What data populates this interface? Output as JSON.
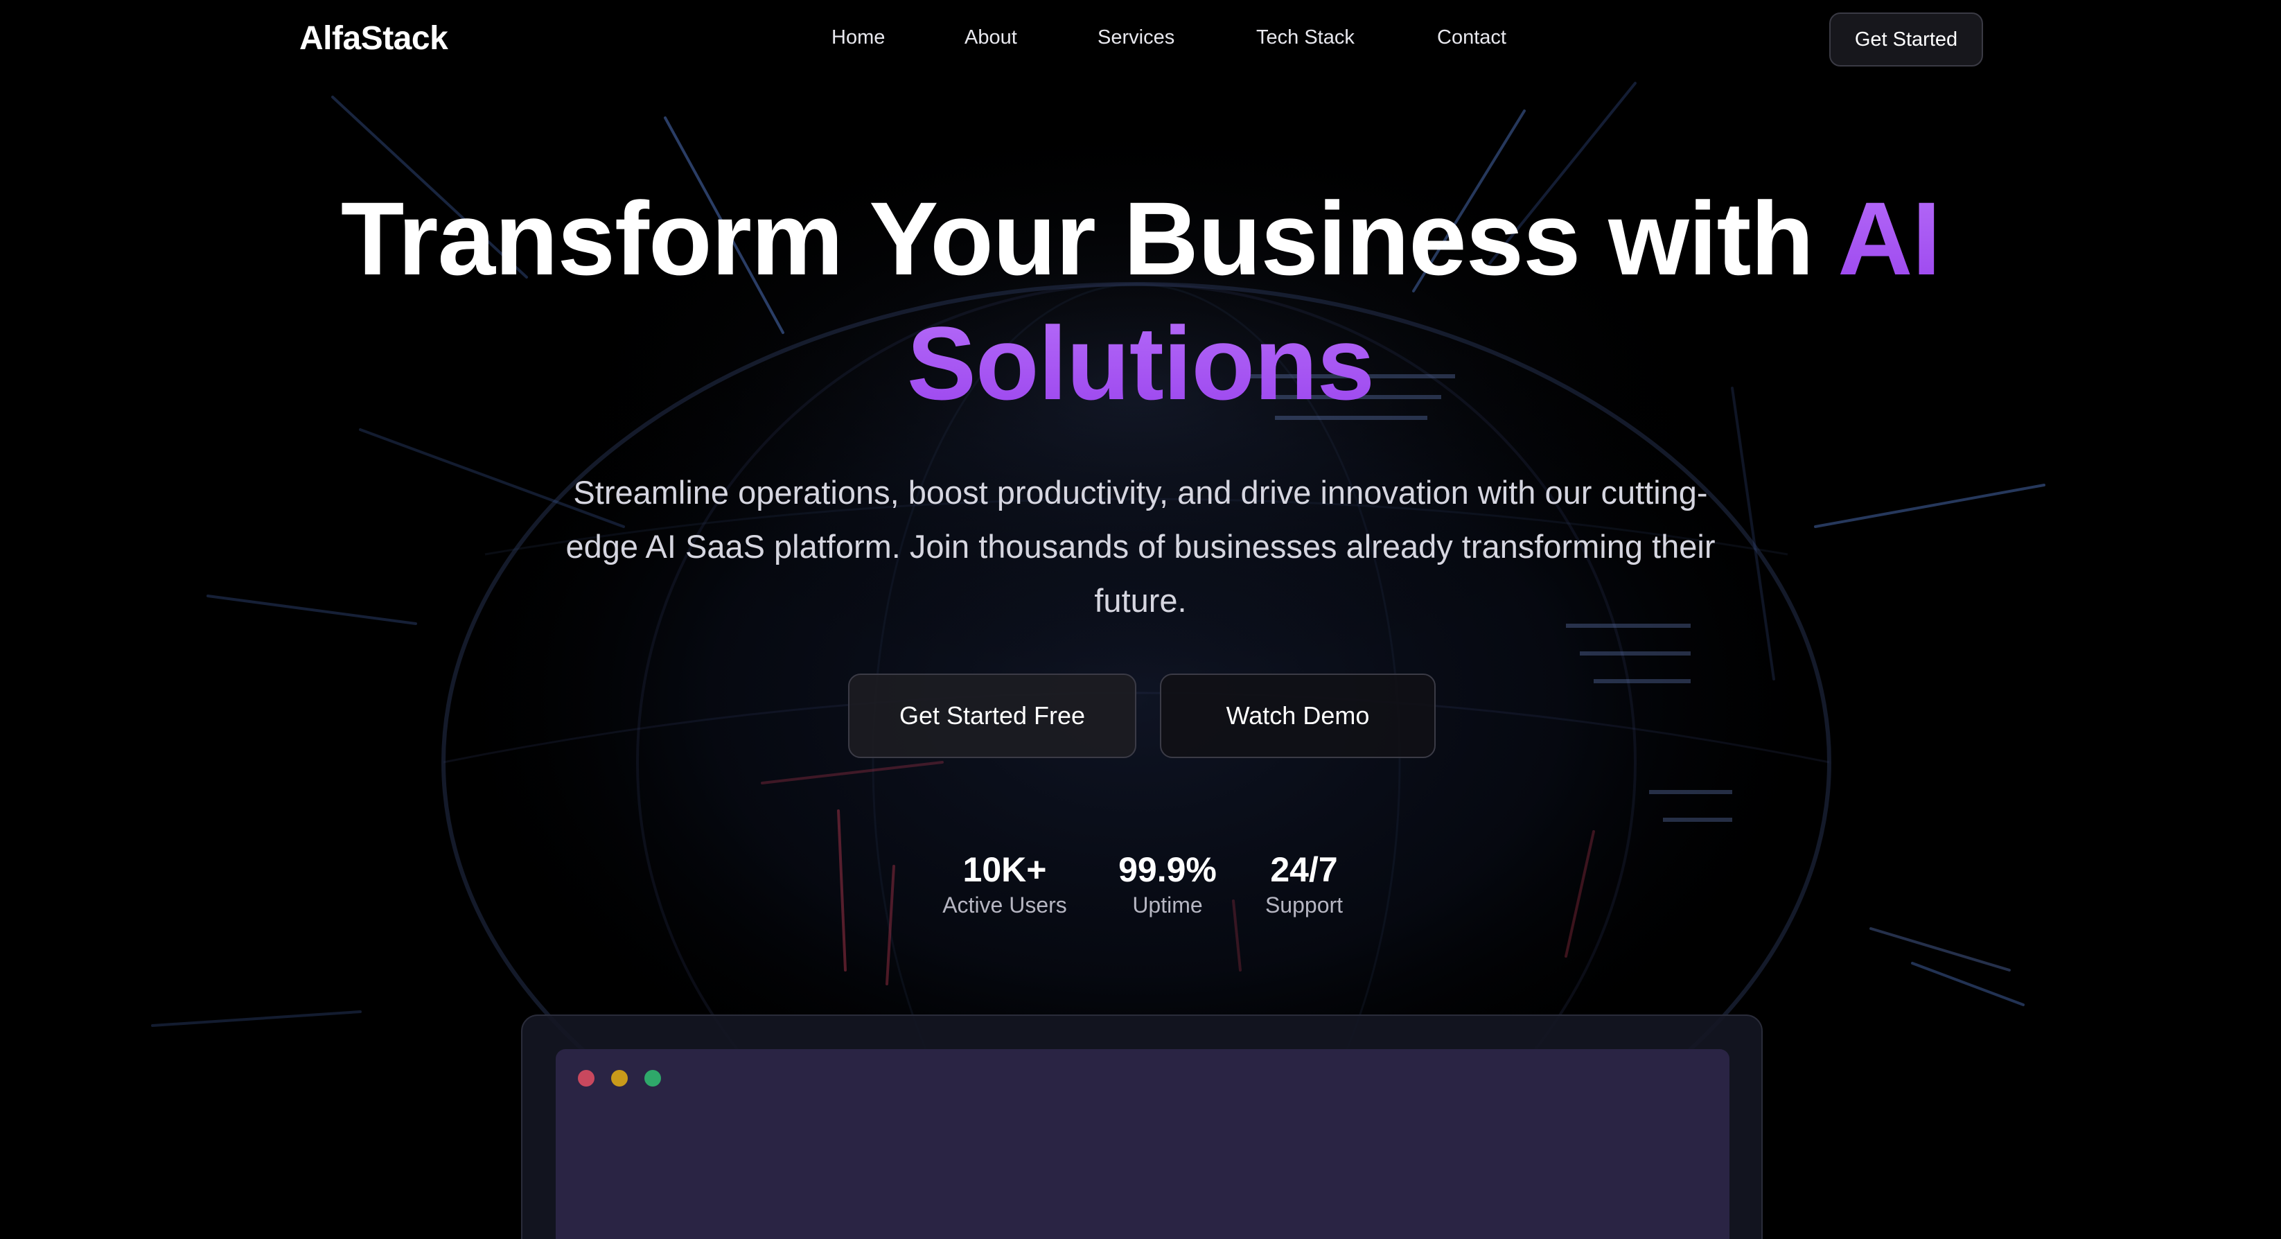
{
  "brand": {
    "name": "AlfaStack",
    "accent_color": "#a855f7"
  },
  "nav": {
    "links": [
      "Home",
      "About",
      "Services",
      "Tech Stack",
      "Contact"
    ],
    "cta_label": "Get Started"
  },
  "hero": {
    "title_main": "Transform Your Business with ",
    "title_accent": "AI Solutions",
    "subtitle": "Streamline operations, boost productivity, and drive innovation with our cutting-edge AI SaaS platform. Join thousands of businesses already transforming their future.",
    "primary_button": "Get Started Free",
    "secondary_button": "Watch Demo"
  },
  "stats": [
    {
      "value": "10K+",
      "label": "Active Users"
    },
    {
      "value": "99.9%",
      "label": "Uptime"
    },
    {
      "value": "24/7",
      "label": "Support"
    }
  ],
  "preview": {
    "window_dots": [
      "#c9485e",
      "#c99a1a",
      "#2fa86a"
    ]
  }
}
